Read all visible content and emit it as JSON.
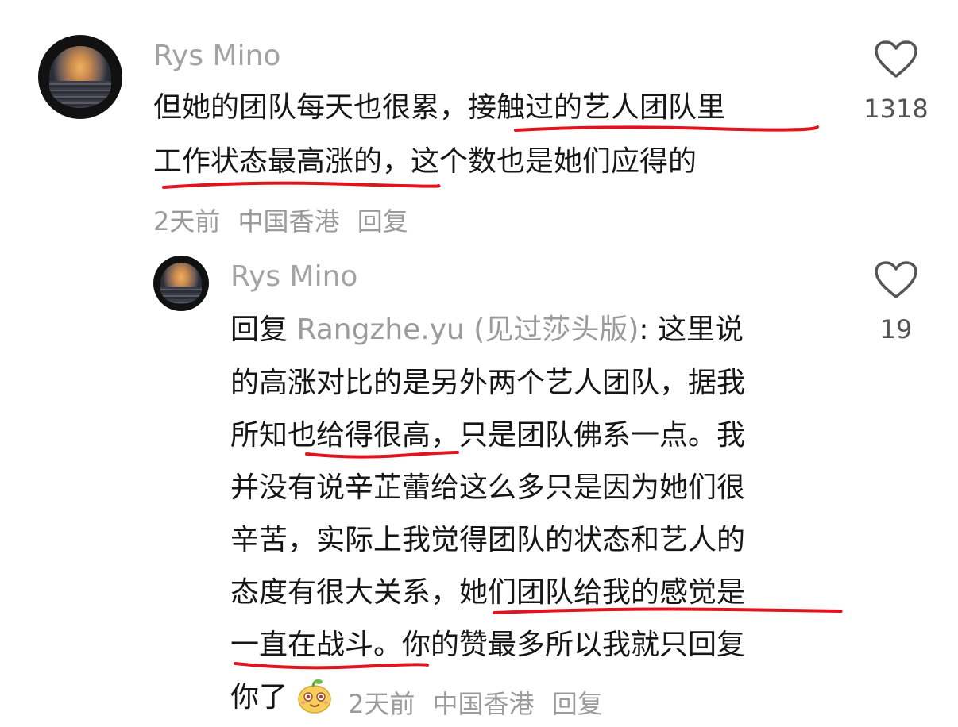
{
  "comment": {
    "username": "Rys Mino",
    "lines": [
      "但她的团队每天也很累，接触过的艺人团队里",
      "工作状态最高涨的，这个数也是她们应得的"
    ],
    "time": "2天前",
    "location": "中国香港",
    "reply_label": "回复",
    "likes": "1318"
  },
  "reply": {
    "username": "Rys Mino",
    "reply_prefix": "回复",
    "reply_target": "Rangzhe.yu (见过莎头版)",
    "first_line_rest": ": 这里说",
    "lines": [
      "的高涨对比的是另外两个艺人团队，据我",
      "所知也给得很高，只是团队佛系一点。我",
      "并没有说辛芷蕾给这么多只是因为她们很",
      "辛苦，实际上我觉得团队的状态和艺人的",
      "态度有很大关系，她们团队给我的感觉是",
      "一直在战斗。你的赞最多所以我就只回复"
    ],
    "last_line": "你了",
    "emoji": "smiling-bean-emoji",
    "time": "2天前",
    "location": "中国香港",
    "reply_label": "回复",
    "likes": "19"
  },
  "colors": {
    "text": "#161616",
    "meta": "#9b9b9b",
    "underline": "#e0141e"
  }
}
